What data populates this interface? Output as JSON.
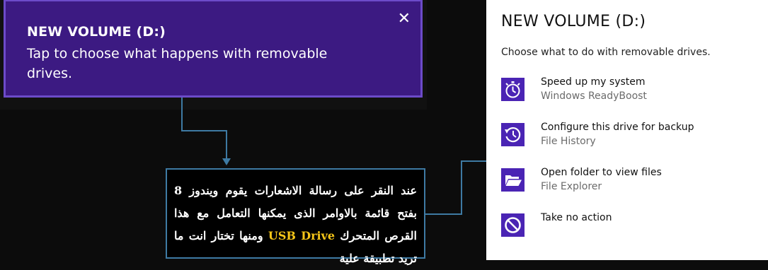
{
  "toast": {
    "title": "NEW VOLUME (D:)",
    "body": "Tap to choose what happens with removable drives.",
    "close_glyph": "✕",
    "colors": {
      "background": "#3c1a82",
      "border": "#6c4bc9"
    }
  },
  "callout": {
    "text_main": "عند النقر على رسالة الاشعارات يقوم ويندوز 8 بفتح قائمة بالاوامر الذى يمكنها التعامل مع هذا القرص المتحرك",
    "highlight": "USB Drive",
    "text_tail": "ومنها تختار انت ما تريد تطبيقة علية",
    "colors": {
      "border": "#3e7aa3",
      "highlight": "#f5c518"
    }
  },
  "panel": {
    "title": "NEW VOLUME (D:)",
    "subtitle": "Choose what to do with removable drives.",
    "icon_color": "#4a24b4",
    "options": [
      {
        "icon": "stopwatch-icon",
        "title": "Speed up my system",
        "subtitle": "Windows ReadyBoost"
      },
      {
        "icon": "history-clock-icon",
        "title": "Configure this drive for backup",
        "subtitle": "File History"
      },
      {
        "icon": "folder-open-icon",
        "title": "Open folder to view files",
        "subtitle": "File Explorer"
      },
      {
        "icon": "no-action-icon",
        "title": "Take no action",
        "subtitle": ""
      }
    ]
  }
}
